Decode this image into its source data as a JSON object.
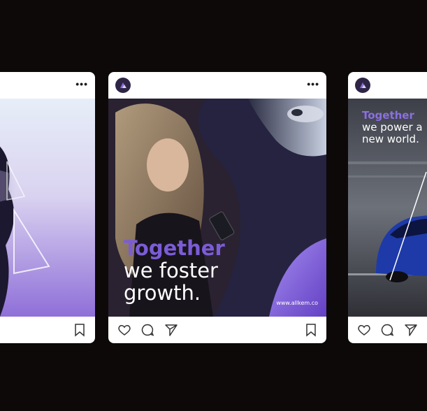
{
  "posts": [
    {
      "more_label": "•••"
    },
    {
      "more_label": "•••",
      "headline": {
        "accent": "Together",
        "line1": "we foster",
        "line2": "growth."
      },
      "url": "www.allkem.co"
    },
    {
      "headline": {
        "accent": "Together",
        "line1": "we power a",
        "line2": "new world."
      }
    }
  ],
  "colors": {
    "background": "#0d0908",
    "card": "#ffffff",
    "brand_purple": "#7b5cd6",
    "navy": "#2e2546"
  },
  "icons": [
    "like-icon",
    "comment-icon",
    "share-icon",
    "bookmark-icon",
    "more-icon",
    "avatar"
  ]
}
